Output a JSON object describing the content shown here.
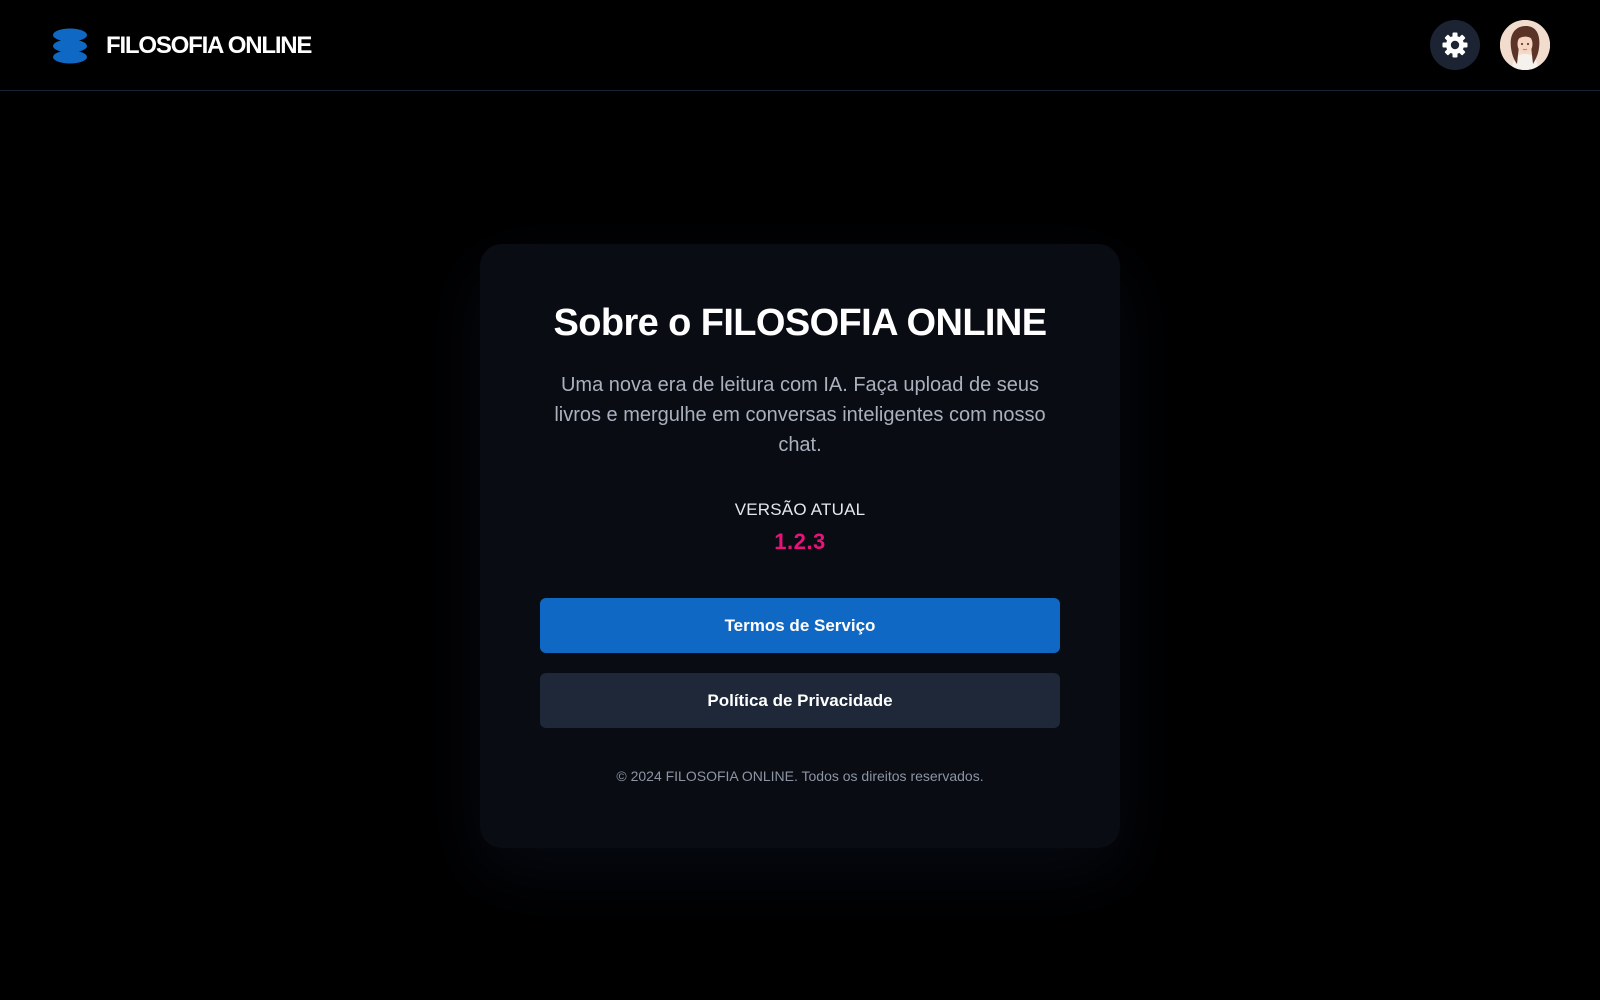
{
  "header": {
    "brand_name": "FILOSOFIA ONLINE",
    "logo_icon": "stacked-disc-logo-icon",
    "settings_icon": "gear-icon",
    "avatar": "user-avatar"
  },
  "about": {
    "title": "Sobre o FILOSOFIA ONLINE",
    "description": "Uma nova era de leitura com IA. Faça upload de seus livros e mergulhe em conversas inteligentes com nosso chat.",
    "version_label": "VERSÃO ATUAL",
    "version_value": "1.2.3",
    "terms_button": "Termos de Serviço",
    "privacy_button": "Política de Privacidade",
    "footer": "© 2024 FILOSOFIA ONLINE. Todos os direitos reservados."
  },
  "colors": {
    "background": "#000000",
    "card": "#090c13",
    "primary": "#0f68c4",
    "secondary": "#1e2838",
    "accent": "#e8127a",
    "logo": "#0f68c4"
  }
}
